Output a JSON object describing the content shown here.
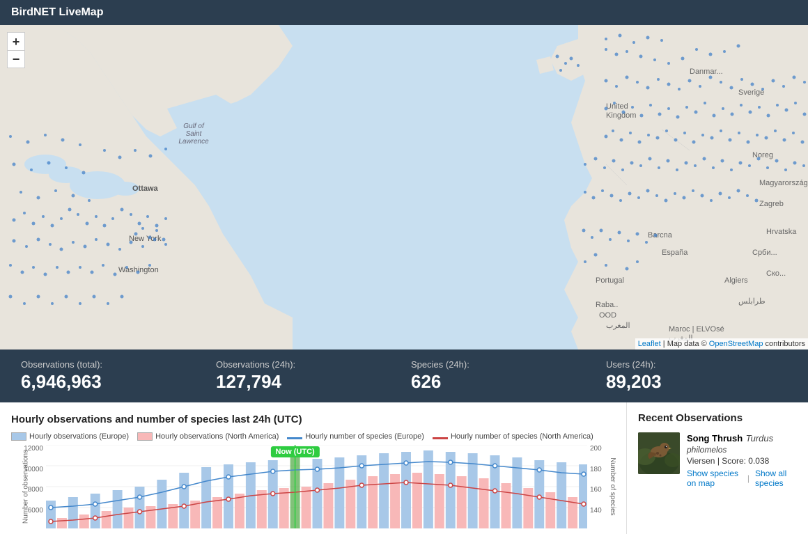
{
  "header": {
    "title": "BirdNET LiveMap"
  },
  "map": {
    "zoom_in_label": "+",
    "zoom_out_label": "−",
    "attribution_leaflet": "Leaflet",
    "attribution_map": "Map data ©",
    "attribution_osm": "OpenStreetMap",
    "attribution_contributors": "contributors"
  },
  "stats": [
    {
      "label": "Observations (total):",
      "value": "6,946,963"
    },
    {
      "label": "Observations (24h):",
      "value": "127,794"
    },
    {
      "label": "Species (24h):",
      "value": "626"
    },
    {
      "label": "Users (24h):",
      "value": "89,203"
    }
  ],
  "chart": {
    "title": "Hourly observations and number of species last 24h (UTC)",
    "now_label": "Now (UTC)",
    "legend": [
      {
        "type": "box",
        "color": "#a8c8e8",
        "label": "Hourly observations (Europe)"
      },
      {
        "type": "box",
        "color": "#f8b8b8",
        "label": "Hourly observations (North America)"
      },
      {
        "type": "line",
        "color": "#4488cc",
        "label": "Hourly number of species (Europe)"
      },
      {
        "type": "line",
        "color": "#cc4444",
        "label": "Hourly number of species (North America)"
      }
    ],
    "y_left_label": "Number of observations",
    "y_right_label": "Number of species",
    "y_left_max": "12000",
    "y_right_max": "200"
  },
  "recent_observations": {
    "title": "Recent Observations",
    "items": [
      {
        "common_name": "Song Thrush",
        "scientific_genus": "Turdus",
        "scientific_species": "philomelos",
        "location": "Viersen",
        "score": "0.038",
        "show_species_map_link": "Show species on map",
        "show_all_link": "Show all species"
      }
    ]
  }
}
